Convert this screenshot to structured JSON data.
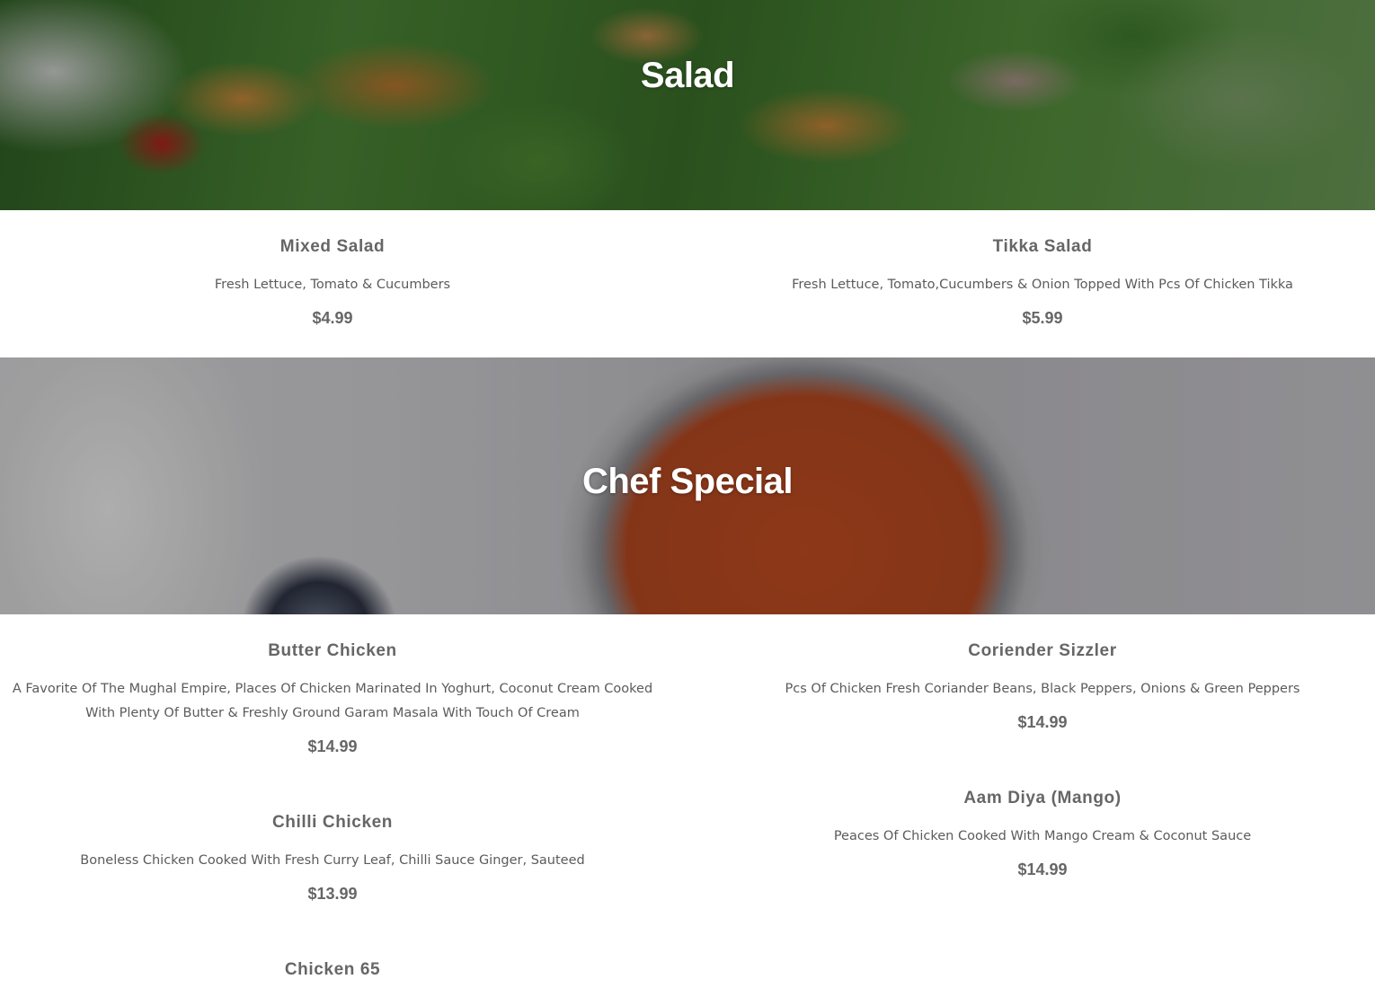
{
  "sections": {
    "salad": {
      "title": "Salad",
      "items": [
        {
          "name": "Mixed Salad",
          "description": "Fresh Lettuce, Tomato & Cucumbers",
          "price": "$4.99"
        },
        {
          "name": "Tikka Salad",
          "description": "Fresh Lettuce, Tomato,Cucumbers & Onion Topped With Pcs Of Chicken Tikka",
          "price": "$5.99"
        }
      ]
    },
    "chef_special": {
      "title": "Chef Special",
      "items": [
        {
          "name": "Butter Chicken",
          "description": "A Favorite Of The Mughal Empire, Places Of Chicken Marinated In Yoghurt, Coconut Cream Cooked With Plenty Of Butter & Freshly Ground Garam Masala With Touch Of Cream",
          "price": "$14.99"
        },
        {
          "name": "Coriender Sizzler",
          "description": "Pcs Of Chicken Fresh Coriander Beans, Black Peppers, Onions & Green Peppers",
          "price": "$14.99"
        },
        {
          "name": "Chilli Chicken",
          "description": "Boneless Chicken Cooked With Fresh Curry Leaf, Chilli Sauce Ginger, Sauteed",
          "price": "$13.99"
        },
        {
          "name": "Aam Diya (Mango)",
          "description": "Peaces Of Chicken Cooked With Mango Cream & Coconut Sauce",
          "price": "$14.99"
        },
        {
          "name": "Chicken 65"
        }
      ]
    }
  }
}
